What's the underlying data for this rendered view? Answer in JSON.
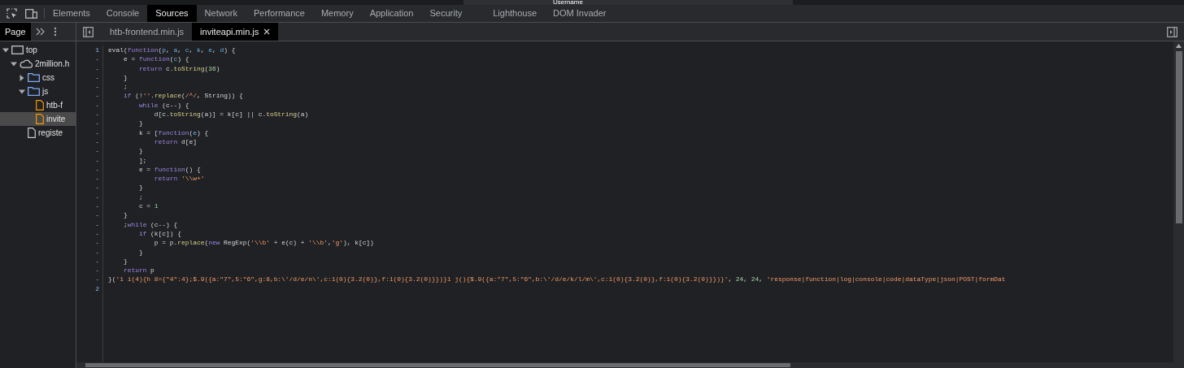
{
  "page_behind": {
    "label": "Username"
  },
  "main_tabs": [
    {
      "label": "Elements",
      "selected": false
    },
    {
      "label": "Console",
      "selected": false
    },
    {
      "label": "Sources",
      "selected": true
    },
    {
      "label": "Network",
      "selected": false
    },
    {
      "label": "Performance",
      "selected": false
    },
    {
      "label": "Memory",
      "selected": false
    },
    {
      "label": "Application",
      "selected": false
    },
    {
      "label": "Security",
      "selected": false
    },
    {
      "label": "Lighthouse",
      "selected": false
    },
    {
      "label": "DOM Invader",
      "selected": false
    }
  ],
  "navigator": {
    "tabs": [
      {
        "label": "Page",
        "selected": true
      }
    ],
    "tree": [
      {
        "kind": "frame",
        "label": "top",
        "expanded": true,
        "selected": false,
        "children": [
          {
            "kind": "origin",
            "label": "2million.h",
            "expanded": true,
            "selected": false,
            "children": [
              {
                "kind": "folder",
                "label": "css",
                "expanded": false,
                "selected": false
              },
              {
                "kind": "folder",
                "label": "js",
                "expanded": true,
                "selected": false,
                "children": [
                  {
                    "kind": "script",
                    "label": "htb-f",
                    "selected": false
                  },
                  {
                    "kind": "script",
                    "label": "invite",
                    "selected": true
                  }
                ]
              },
              {
                "kind": "document",
                "label": "registe",
                "selected": false
              }
            ]
          }
        ]
      }
    ]
  },
  "editor_tabs": [
    {
      "label": "htb-frontend.min.js",
      "selected": false
    },
    {
      "label": "inviteapi.min.js",
      "selected": true
    }
  ],
  "code_lines": [
    {
      "number": "1",
      "tokens": [
        {
          "kind": "plain",
          "text": "eval("
        },
        {
          "kind": "keyword",
          "text": "function"
        },
        {
          "kind": "plain",
          "text": "("
        },
        {
          "kind": "param",
          "text": "p"
        },
        {
          "kind": "plain",
          "text": ", "
        },
        {
          "kind": "param",
          "text": "a"
        },
        {
          "kind": "plain",
          "text": ", "
        },
        {
          "kind": "param",
          "text": "c"
        },
        {
          "kind": "plain",
          "text": ", "
        },
        {
          "kind": "param",
          "text": "k"
        },
        {
          "kind": "plain",
          "text": ", "
        },
        {
          "kind": "param",
          "text": "e"
        },
        {
          "kind": "plain",
          "text": ", "
        },
        {
          "kind": "param",
          "text": "d"
        },
        {
          "kind": "plain",
          "text": ") {"
        }
      ]
    },
    {
      "number": "-",
      "tokens": [
        {
          "kind": "plain",
          "text": "    e = "
        },
        {
          "kind": "keyword",
          "text": "function"
        },
        {
          "kind": "plain",
          "text": "("
        },
        {
          "kind": "param",
          "text": "c"
        },
        {
          "kind": "plain",
          "text": ") {"
        }
      ]
    },
    {
      "number": "-",
      "tokens": [
        {
          "kind": "keyword",
          "text": "        return"
        },
        {
          "kind": "plain",
          "text": " c."
        },
        {
          "kind": "method",
          "text": "toString"
        },
        {
          "kind": "plain",
          "text": "("
        },
        {
          "kind": "number",
          "text": "36"
        },
        {
          "kind": "plain",
          "text": ")"
        }
      ]
    },
    {
      "number": "-",
      "tokens": [
        {
          "kind": "plain",
          "text": "    }"
        }
      ]
    },
    {
      "number": "-",
      "tokens": [
        {
          "kind": "plain",
          "text": "    ;"
        }
      ]
    },
    {
      "number": "-",
      "tokens": [
        {
          "kind": "keyword",
          "text": "    if"
        },
        {
          "kind": "plain",
          "text": " (!"
        },
        {
          "kind": "string",
          "text": "''"
        },
        {
          "kind": "plain",
          "text": "."
        },
        {
          "kind": "method",
          "text": "replace"
        },
        {
          "kind": "plain",
          "text": "("
        },
        {
          "kind": "string",
          "text": "/^/"
        },
        {
          "kind": "plain",
          "text": ", String)) {"
        }
      ]
    },
    {
      "number": "-",
      "tokens": [
        {
          "kind": "keyword",
          "text": "        while"
        },
        {
          "kind": "plain",
          "text": " (c--) {"
        }
      ]
    },
    {
      "number": "-",
      "tokens": [
        {
          "kind": "plain",
          "text": "            d[c."
        },
        {
          "kind": "method",
          "text": "toString"
        },
        {
          "kind": "plain",
          "text": "(a)] = k[c] || c."
        },
        {
          "kind": "method",
          "text": "toString"
        },
        {
          "kind": "plain",
          "text": "(a)"
        }
      ]
    },
    {
      "number": "-",
      "tokens": [
        {
          "kind": "plain",
          "text": "        }"
        }
      ]
    },
    {
      "number": "-",
      "tokens": [
        {
          "kind": "plain",
          "text": "        k = ["
        },
        {
          "kind": "keyword",
          "text": "function"
        },
        {
          "kind": "plain",
          "text": "("
        },
        {
          "kind": "param",
          "text": "e"
        },
        {
          "kind": "plain",
          "text": ") {"
        }
      ]
    },
    {
      "number": "-",
      "tokens": [
        {
          "kind": "keyword",
          "text": "            return"
        },
        {
          "kind": "plain",
          "text": " d[e]"
        }
      ]
    },
    {
      "number": "-",
      "tokens": [
        {
          "kind": "plain",
          "text": "        }"
        }
      ]
    },
    {
      "number": "-",
      "tokens": [
        {
          "kind": "plain",
          "text": "        ];"
        }
      ]
    },
    {
      "number": "-",
      "tokens": [
        {
          "kind": "plain",
          "text": "        e = "
        },
        {
          "kind": "keyword",
          "text": "function"
        },
        {
          "kind": "plain",
          "text": "() {"
        }
      ]
    },
    {
      "number": "-",
      "tokens": [
        {
          "kind": "keyword",
          "text": "            return "
        },
        {
          "kind": "string",
          "text": "'\\\\w+'"
        }
      ]
    },
    {
      "number": "-",
      "tokens": [
        {
          "kind": "plain",
          "text": "        }"
        }
      ]
    },
    {
      "number": "-",
      "tokens": [
        {
          "kind": "plain",
          "text": "        ;"
        }
      ]
    },
    {
      "number": "-",
      "tokens": [
        {
          "kind": "plain",
          "text": "        c = "
        },
        {
          "kind": "number",
          "text": "1"
        }
      ]
    },
    {
      "number": "-",
      "tokens": [
        {
          "kind": "plain",
          "text": "    }"
        }
      ]
    },
    {
      "number": "-",
      "tokens": [
        {
          "kind": "plain",
          "text": "    ;"
        },
        {
          "kind": "keyword",
          "text": "while"
        },
        {
          "kind": "plain",
          "text": " (c--) {"
        }
      ]
    },
    {
      "number": "-",
      "tokens": [
        {
          "kind": "keyword",
          "text": "        if"
        },
        {
          "kind": "plain",
          "text": " (k[c]) {"
        }
      ]
    },
    {
      "number": "-",
      "tokens": [
        {
          "kind": "plain",
          "text": "            p = p."
        },
        {
          "kind": "method",
          "text": "replace"
        },
        {
          "kind": "plain",
          "text": "("
        },
        {
          "kind": "keyword",
          "text": "new"
        },
        {
          "kind": "plain",
          "text": " RegExp("
        },
        {
          "kind": "string",
          "text": "'\\\\b'"
        },
        {
          "kind": "plain",
          "text": " + e(c) + "
        },
        {
          "kind": "string",
          "text": "'\\\\b'"
        },
        {
          "kind": "plain",
          "text": ","
        },
        {
          "kind": "string",
          "text": "'g'"
        },
        {
          "kind": "plain",
          "text": "), k[c])"
        }
      ]
    },
    {
      "number": "-",
      "tokens": [
        {
          "kind": "plain",
          "text": "        }"
        }
      ]
    },
    {
      "number": "-",
      "tokens": [
        {
          "kind": "plain",
          "text": "    }"
        }
      ]
    },
    {
      "number": "-",
      "tokens": [
        {
          "kind": "keyword",
          "text": "    return"
        },
        {
          "kind": "plain",
          "text": " p"
        }
      ]
    },
    {
      "number": "-",
      "tokens": [
        {
          "kind": "plain",
          "text": "}("
        },
        {
          "kind": "string",
          "text": "'1 i(4){h 8={\"4\":4};$.9({a:\"7\",5:\"6\",g:8,b:\\'/d/e/n\\',c:1(0){3.2(0)},f:1(0){3.2(0)}})}1 j(){$.9({a:\"7\",5:\"6\",b:\\'/d/e/k/l/m\\',c:1(0){3.2(0)},f:1(0){3.2(0)}})}'"
        },
        {
          "kind": "plain",
          "text": ", "
        },
        {
          "kind": "number",
          "text": "24"
        },
        {
          "kind": "plain",
          "text": ", "
        },
        {
          "kind": "number",
          "text": "24"
        },
        {
          "kind": "plain",
          "text": ", "
        },
        {
          "kind": "string",
          "text": "'response|function|log|console|code|dataType|json|POST|formDat"
        }
      ]
    },
    {
      "number": "2"
    }
  ]
}
